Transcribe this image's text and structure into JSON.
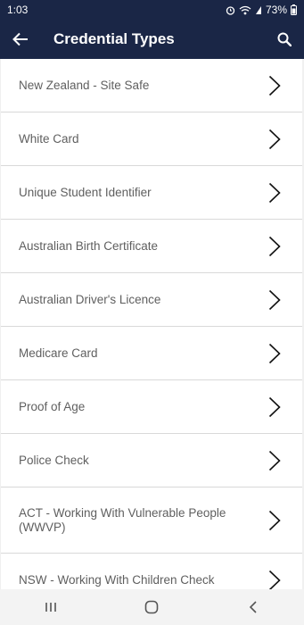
{
  "status": {
    "time": "1:03",
    "battery": "73%"
  },
  "header": {
    "title": "Credential Types"
  },
  "items": [
    {
      "label": "New Zealand - Site Safe"
    },
    {
      "label": "White Card"
    },
    {
      "label": "Unique Student Identifier"
    },
    {
      "label": "Australian Birth Certificate"
    },
    {
      "label": "Australian Driver's Licence"
    },
    {
      "label": "Medicare Card"
    },
    {
      "label": "Proof of Age"
    },
    {
      "label": "Police Check"
    },
    {
      "label": "ACT - Working With Vulnerable People (WWVP)"
    },
    {
      "label": "NSW - Working With Children Check"
    }
  ],
  "icons": {
    "back": "arrow-left-icon",
    "search": "search-icon",
    "row": "chevron-right-icon",
    "nav": [
      "recents-icon",
      "home-icon",
      "back-icon"
    ]
  },
  "colors": {
    "header_bg": "#1a2646",
    "row_bg": "#ffffff",
    "text": "#5f5f5f"
  }
}
